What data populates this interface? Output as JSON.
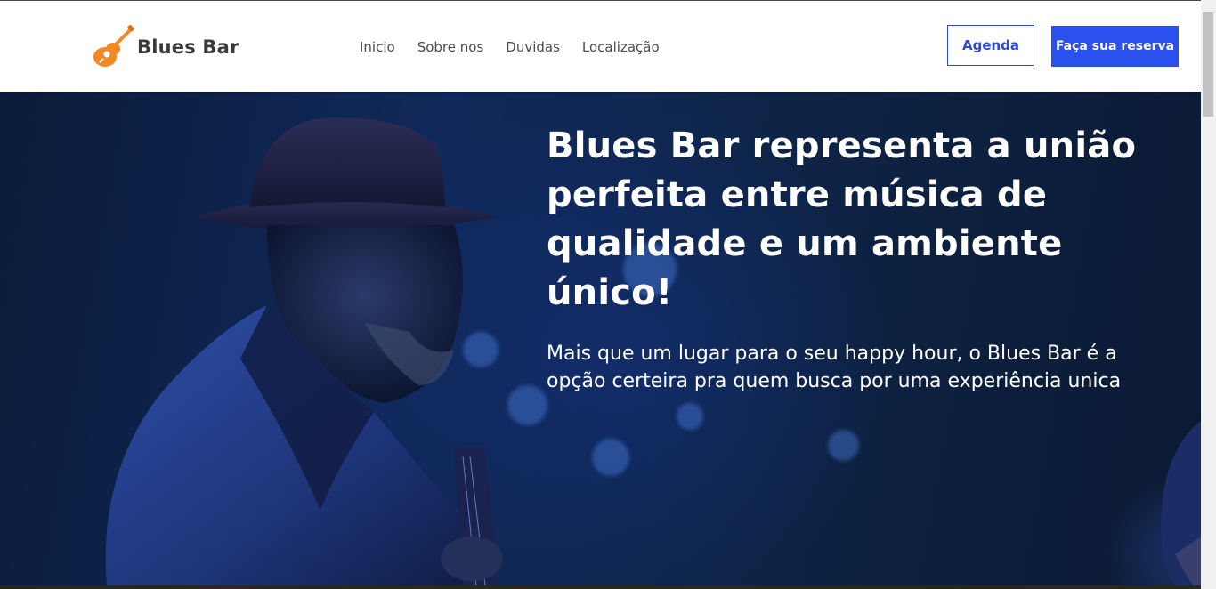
{
  "brand": {
    "name": "Blues Bar",
    "icon": "guitar-icon",
    "icon_color": "#f08a24"
  },
  "nav": {
    "links": [
      {
        "label": "Inicio"
      },
      {
        "label": "Sobre nos"
      },
      {
        "label": "Duvidas"
      },
      {
        "label": "Localização"
      }
    ],
    "agenda_label": "Agenda",
    "reserva_label": "Faça sua reserva"
  },
  "hero": {
    "title": "Blues Bar representa a união perfeita entre música de qualidade e um ambiente único!",
    "subtitle": "Mais que um lugar para o seu happy hour, o Blues Bar é a opção certeira pra quem busca por uma experiência unica"
  },
  "colors": {
    "accent": "#2b50f0",
    "outline_accent": "#2a4bd8",
    "hero_background": "#0b1a33"
  }
}
